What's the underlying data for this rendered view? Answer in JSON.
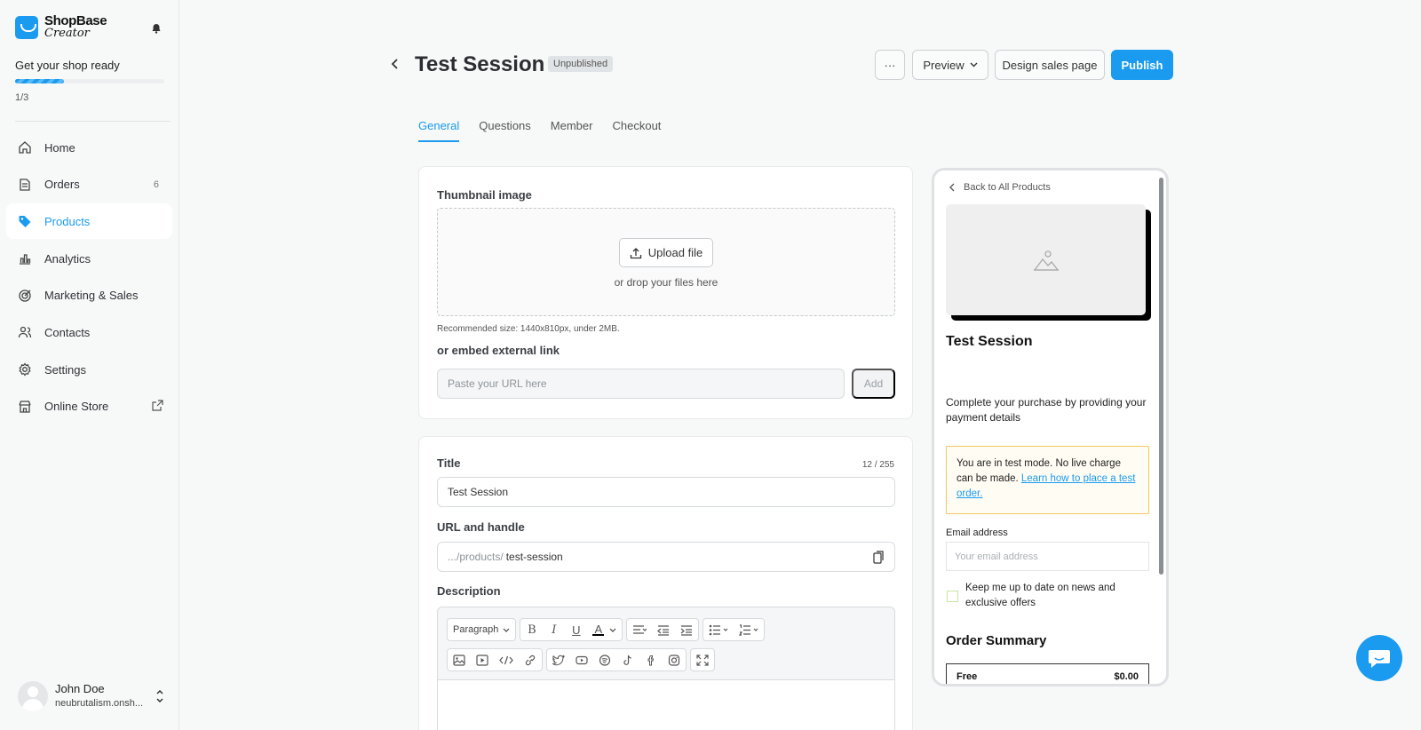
{
  "brand": {
    "name": "ShopBase",
    "sub": "Creator",
    "color": "#1a9bf0"
  },
  "onboarding": {
    "label": "Get your shop ready",
    "step": "1/3",
    "progress": 0.33
  },
  "nav": [
    {
      "label": "Home",
      "icon": "home-icon"
    },
    {
      "label": "Orders",
      "icon": "orders-icon",
      "count": "6"
    },
    {
      "label": "Products",
      "icon": "tag-icon",
      "active": true
    },
    {
      "label": "Analytics",
      "icon": "bar-chart-icon"
    },
    {
      "label": "Marketing & Sales",
      "icon": "target-icon"
    },
    {
      "label": "Contacts",
      "icon": "contacts-icon"
    },
    {
      "label": "Settings",
      "icon": "gear-icon"
    },
    {
      "label": "Online Store",
      "icon": "store-icon"
    }
  ],
  "user": {
    "name": "John Doe",
    "shop": "neubrutalism.onsh..."
  },
  "header": {
    "title": "Test Session",
    "status": "Unpublished",
    "more": "···",
    "preview": "Preview",
    "design": "Design sales page",
    "publish": "Publish"
  },
  "tabs": [
    "General",
    "Questions",
    "Member",
    "Checkout"
  ],
  "thumbnail": {
    "label": "Thumbnail image",
    "upload": "Upload file",
    "drop": "or drop your files here",
    "hint": "Recommended size: 1440x810px, under 2MB.",
    "embed_label": "or embed external link",
    "embed_placeholder": "Paste your URL here",
    "add": "Add"
  },
  "details": {
    "title_label": "Title",
    "title_counter": "12 / 255",
    "title_value": "Test Session",
    "url_label": "URL and handle",
    "url_prefix": ".../products/",
    "url_value": "test-session",
    "desc_label": "Description",
    "paragraph": "Paragraph"
  },
  "preview": {
    "back": "Back to All Products",
    "title": "Test Session",
    "desc": "Complete your purchase by providing your payment details",
    "alert_text": "You are in test mode. No live charge can be made.",
    "alert_link": "Learn how to place a test order.",
    "email_label": "Email address",
    "email_placeholder": "Your email address",
    "newsletter": "Keep me up to date on news and exclusive offers",
    "summary": "Order Summary",
    "row_label": "Free",
    "row_value": "$0.00"
  }
}
